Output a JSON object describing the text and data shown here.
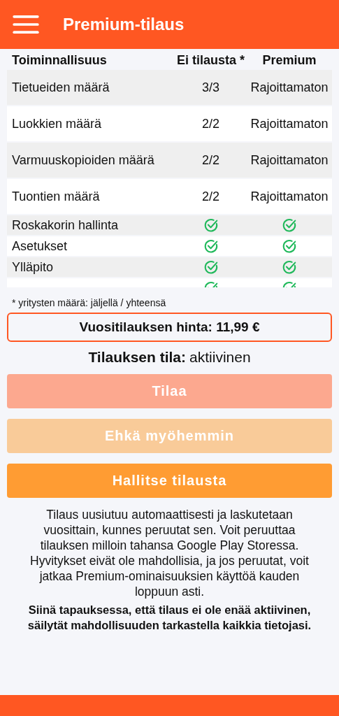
{
  "app_bar": {
    "title": "Premium-tilaus"
  },
  "table": {
    "columns": [
      "Toiminnallisuus",
      "Ei tilausta *",
      "Premium"
    ],
    "rows": [
      {
        "label": "Tietueiden määrä",
        "free": {
          "kind": "text",
          "text": "3/3"
        },
        "premium": {
          "kind": "text",
          "text": "Rajoittamaton"
        }
      },
      {
        "label": "Luokkien määrä",
        "free": {
          "kind": "text",
          "text": "2/2"
        },
        "premium": {
          "kind": "text",
          "text": "Rajoittamaton"
        }
      },
      {
        "label": "Varmuuskopioiden määrä",
        "free": {
          "kind": "text",
          "text": "2/2"
        },
        "premium": {
          "kind": "text",
          "text": "Rajoittamaton"
        }
      },
      {
        "label": "Tuontien määrä",
        "free": {
          "kind": "text",
          "text": "2/2"
        },
        "premium": {
          "kind": "text",
          "text": "Rajoittamaton"
        }
      },
      {
        "label": "Roskakorin hallinta",
        "free": {
          "kind": "check"
        },
        "premium": {
          "kind": "check"
        }
      },
      {
        "label": "Asetukset",
        "free": {
          "kind": "check"
        },
        "premium": {
          "kind": "check"
        }
      },
      {
        "label": "Ylläpito",
        "free": {
          "kind": "check"
        },
        "premium": {
          "kind": "check"
        }
      },
      {
        "free": {
          "kind": "check"
        },
        "premium": {
          "kind": "check"
        }
      }
    ]
  },
  "footnote": "* yritysten määrä: jäljellä / yhteensä",
  "price": "Vuositilauksen hinta: 11,99 €",
  "status": {
    "label": "Tilauksen tila:",
    "value": "aktiivinen"
  },
  "buttons": [
    {
      "label": "Tilaa",
      "kind": "primary",
      "disabled": true
    },
    {
      "label": "Ehkä myöhemmin",
      "kind": "secondary",
      "disabled": true
    },
    {
      "label": "Hallitse tilausta",
      "kind": "secondary",
      "disabled": false
    }
  ],
  "info": "Tilaus uusiutuu automaattisesti ja laskutetaan vuosittain, kunnes peruutat sen. Voit peruuttaa tilauksen milloin tahansa Google Play Storessa. Hyvitykset eivät ole mahdollisia, ja jos peruutat, voit jatkaa Premium-ominaisuuksien käyttöä kauden loppuun asti.",
  "note": "Siinä tapauksessa, että tilaus ei ole enää aktiivinen, säilytät mahdollisuuden tarkastella kaikkia tietojasi."
}
